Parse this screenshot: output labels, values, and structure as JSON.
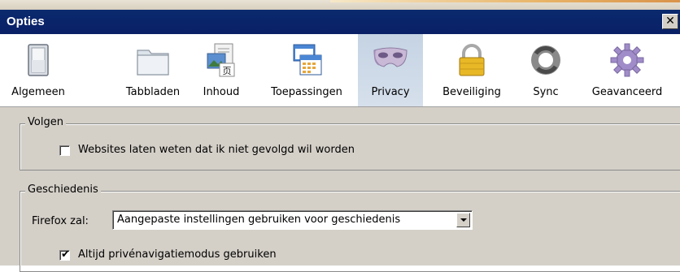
{
  "window": {
    "title": "Opties",
    "close_symbol": "✕"
  },
  "toolbar": {
    "tabs": [
      {
        "label": "Algemeen",
        "icon": "switch-icon"
      },
      {
        "label": "Tabbladen",
        "icon": "folder-tabs-icon"
      },
      {
        "label": "Inhoud",
        "icon": "document-image-icon"
      },
      {
        "label": "Toepassingen",
        "icon": "applications-calendar-icon"
      },
      {
        "label": "Privacy",
        "icon": "mask-icon",
        "selected": true
      },
      {
        "label": "Beveiliging",
        "icon": "padlock-icon"
      },
      {
        "label": "Sync",
        "icon": "sync-icon"
      },
      {
        "label": "Geavanceerd",
        "icon": "gear-icon"
      }
    ],
    "selected_bg": "#c9d6e6"
  },
  "volgen": {
    "legend": "Volgen",
    "dnt_label": "Websites laten weten dat ik niet gevolgd wil worden",
    "dnt_checked": false
  },
  "geschiedenis": {
    "legend": "Geschiedenis",
    "firefox_label": "Firefox zal:",
    "history_select": "Aangepaste instellingen gebruiken voor geschiedenis",
    "private_label": "Altijd privénavigatiemodus gebruiken",
    "private_checked": true,
    "check_glyph": "✔"
  },
  "colors": {
    "titlebar": "#0a246a",
    "dialog_bg": "#d4d0c8"
  }
}
